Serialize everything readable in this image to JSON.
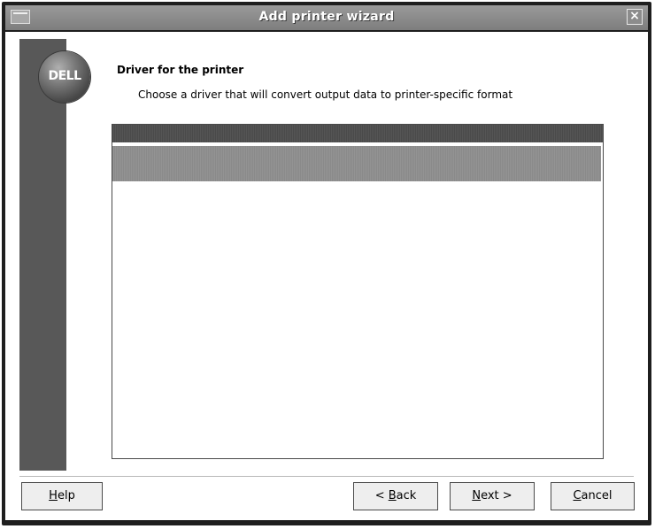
{
  "window": {
    "title": "Add printer wizard"
  },
  "logo": {
    "text": "DELL"
  },
  "page": {
    "heading": "Driver for the printer",
    "subheading": "Choose a driver that will convert output data to printer-specific format"
  },
  "driver_list": {
    "items": []
  },
  "buttons": {
    "help": {
      "mnemonic": "H",
      "rest": "elp"
    },
    "back": {
      "prefix": "< ",
      "mnemonic": "B",
      "rest": "ack"
    },
    "next": {
      "mnemonic": "N",
      "rest": "ext >"
    },
    "cancel": {
      "mnemonic": "C",
      "rest": "ancel"
    }
  },
  "colors": {
    "titlebar": "#8c8c8c",
    "sidebar": "#585858",
    "selection": "#8e8e8e"
  },
  "icons": {
    "window_menu": "window-menu-icon",
    "close": "close-icon"
  }
}
